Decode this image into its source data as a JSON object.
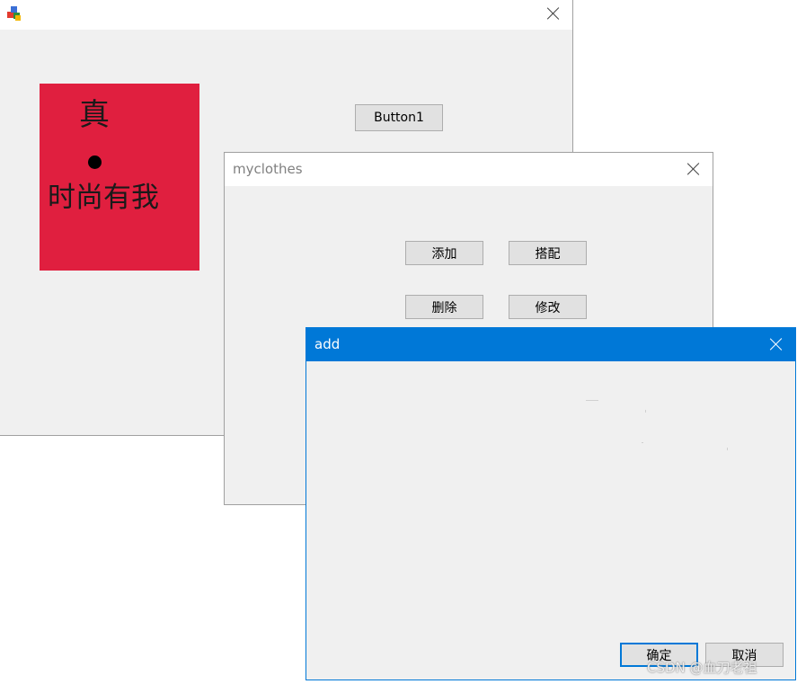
{
  "main_window": {
    "close_icon": "close-icon",
    "app_icon": "app-blocks-icon",
    "panel": {
      "color": "#e01f3f",
      "line1": "真",
      "bullet": "●",
      "line2": "时尚有我"
    },
    "button1_label": "Button1"
  },
  "myclothes_window": {
    "title": "myclothes",
    "buttons": {
      "add": "添加",
      "match": "搭配",
      "delete": "删除",
      "modify": "修改"
    }
  },
  "add_window": {
    "title": "add",
    "accent": "#0078d7",
    "buttons": {
      "ok": "确定",
      "cancel": "取消"
    }
  },
  "watermark": "CSDN @血刀老祖"
}
